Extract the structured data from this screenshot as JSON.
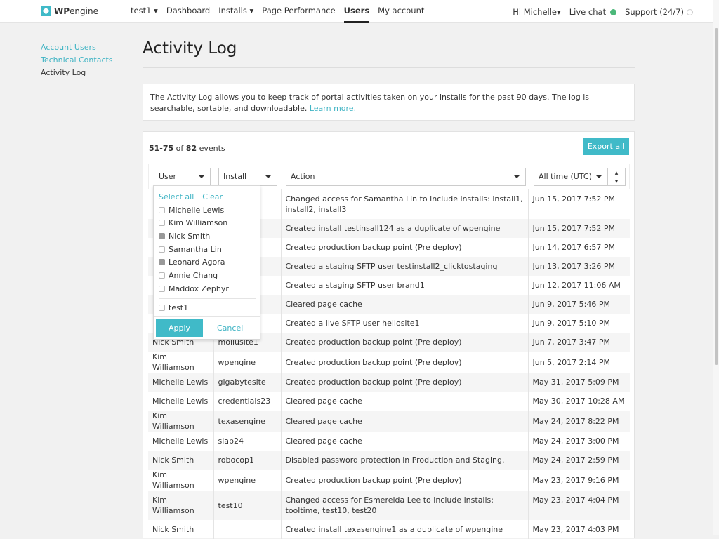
{
  "header": {
    "logo": "WP engine",
    "nav": [
      {
        "label": "test1 ▾"
      },
      {
        "label": "Dashboard"
      },
      {
        "label": "Installs ▾"
      },
      {
        "label": "Page Performance"
      },
      {
        "label": "Users",
        "active": true
      },
      {
        "label": "My account"
      }
    ],
    "greeting": "Hi Michelle▾",
    "live_chat": "Live chat",
    "live_chat_status_color": "#4cb87a",
    "support": "Support (24/7)"
  },
  "sidebar": {
    "items": [
      {
        "label": "Account Users"
      },
      {
        "label": "Technical Contacts"
      },
      {
        "label": "Activity Log",
        "current": true
      }
    ]
  },
  "page_title": "Activity Log",
  "intro": {
    "text": "The Activity Log allows you to keep track of portal activities taken on your installs for the past 90 days. The log is searchable, sortable, and downloadable. ",
    "link": "Learn more."
  },
  "count": {
    "range": "51-75",
    "of": " of ",
    "total": "82",
    "suffix": " events"
  },
  "export_label": "Export all",
  "filters": {
    "user": "User",
    "install": "Install",
    "action": "Action",
    "time": "All time (UTC)"
  },
  "user_dropdown": {
    "select_all": "Select all",
    "clear": "Clear",
    "options": [
      {
        "label": "Michelle Lewis",
        "checked": false
      },
      {
        "label": "Kim Williamson",
        "checked": false
      },
      {
        "label": "Nick Smith",
        "checked": true
      },
      {
        "label": "Samantha Lin",
        "checked": false
      },
      {
        "label": "Leonard Agora",
        "checked": true
      },
      {
        "label": "Annie Chang",
        "checked": false
      },
      {
        "label": "Maddox Zephyr",
        "checked": false
      }
    ],
    "extra_option": {
      "label": "test1",
      "checked": false
    },
    "apply": "Apply",
    "cancel": "Cancel"
  },
  "rows": [
    {
      "user": "",
      "install": "",
      "action": "Changed access for Samantha Lin  to include installs: install1, install2, install3",
      "date": "Jun 15, 2017 7:52 PM",
      "tall": true
    },
    {
      "user": "",
      "install": "",
      "action": "Created install testinsall124 as a duplicate of wpengine",
      "date": "Jun 15, 2017 7:52 PM"
    },
    {
      "user": "",
      "install": "",
      "action": "Created production backup point (Pre deploy)",
      "date": "Jun 14, 2017 6:57 PM"
    },
    {
      "user": "",
      "install": "",
      "action": "Created a staging SFTP user testinstall2_clicktostaging",
      "date": "Jun 13, 2017 3:26 PM"
    },
    {
      "user": "",
      "install": "",
      "action": "Created a staging SFTP user brand1",
      "date": "Jun 12, 2017 11:06 AM"
    },
    {
      "user": "",
      "install": "",
      "action": "Cleared page cache",
      "date": "Jun 9, 2017 5:46 PM"
    },
    {
      "user": "",
      "install": "",
      "action": "Created a live SFTP user hellosite1",
      "date": "Jun 9, 2017 5:10 PM"
    },
    {
      "user": "Nick Smith",
      "install": "mollusite1",
      "action": "Created production backup point (Pre deploy)",
      "date": "Jun 7, 2017 3:47 PM"
    },
    {
      "user": "Kim Williamson",
      "install": "wpengine",
      "action": "Created production backup point (Pre deploy)",
      "date": "Jun 5, 2017 2:14 PM"
    },
    {
      "user": "Michelle Lewis",
      "install": "gigabytesite",
      "action": "Created production backup point (Pre deploy)",
      "date": "May 31, 2017 5:09 PM"
    },
    {
      "user": "Michelle Lewis",
      "install": "credentials23",
      "action": "Cleared page cache",
      "date": "May 30, 2017 10:28 AM"
    },
    {
      "user": "Kim Williamson",
      "install": "texasengine",
      "action": "Cleared page cache",
      "date": "May 24, 2017 8:22 PM"
    },
    {
      "user": "Michelle Lewis",
      "install": "slab24",
      "action": "Cleared page cache",
      "date": "May 24, 2017 3:00 PM"
    },
    {
      "user": "Nick Smith",
      "install": "robocop1",
      "action": "Disabled password protection in Production and Staging.",
      "date": "May 24, 2017 2:59 PM"
    },
    {
      "user": "Kim Williamson",
      "install": "wpengine",
      "action": "Created production backup point (Pre deploy)",
      "date": "May 23, 2017 9:16 PM"
    },
    {
      "user": "Kim Williamson",
      "install": "test10",
      "action": "Changed access for Esmerelda Lee to include installs: tooltime, test10, test20",
      "date": "May 23, 2017 4:04 PM",
      "tall": true
    },
    {
      "user": "Nick Smith",
      "install": "",
      "action": "Created install texasengine1 as a duplicate of wpengine",
      "date": "May 23, 2017 4:03 PM"
    }
  ]
}
